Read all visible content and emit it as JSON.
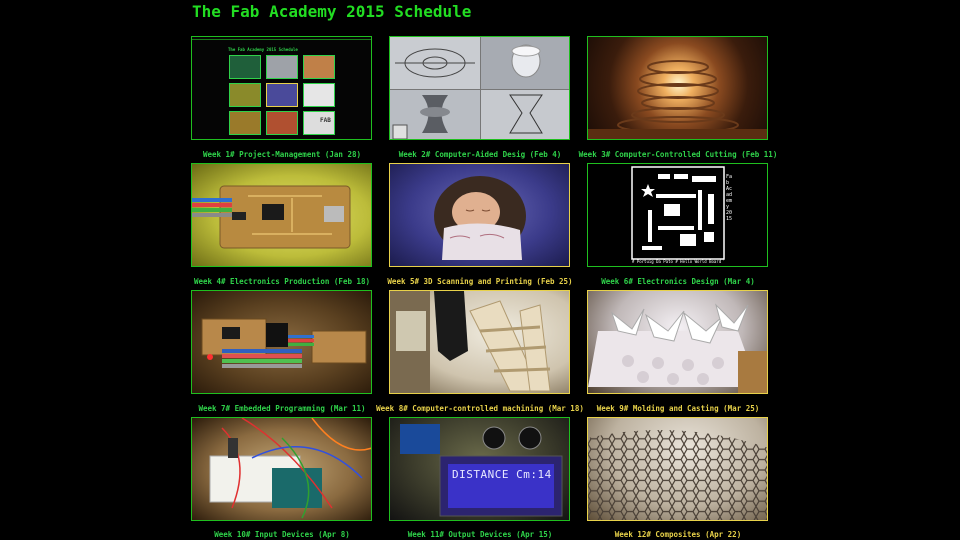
{
  "page": {
    "title": "The Fab Academy 2015 Schedule"
  },
  "weeks": [
    {
      "caption": "Week 1# Project-Management (Jan 28)",
      "image": "website-screenshot-image"
    },
    {
      "caption": "Week 2# Computer-Aided Desig (Feb 4)",
      "image": "cad-render-image"
    },
    {
      "caption": "Week 3# Computer-Controlled Cutting (Feb 11)",
      "image": "lamp-image"
    },
    {
      "caption": "Week 4# Electronics Production (Feb 18)",
      "image": "circuit-board-image"
    },
    {
      "caption": "Week 5# 3D Scanning and Printing (Feb 25)",
      "image": "baby-scan-image"
    },
    {
      "caption": "Week 6# Electronics Design (Mar 4)",
      "image": "pcb-layout-image"
    },
    {
      "caption": "Week 7# Embedded Programming (Mar 11)",
      "image": "programmer-board-image"
    },
    {
      "caption": "Week 8# Computer-controlled machining (Mar 18)",
      "image": "wooden-shelf-image"
    },
    {
      "caption": "Week 9# Molding and Casting (Mar 25)",
      "image": "cast-parts-image"
    },
    {
      "caption": "Week 10# Input Devices (Apr 8)",
      "image": "breadboard-image"
    },
    {
      "caption": "Week 11# Output Devices (Apr 15)",
      "image": "lcd-display-image"
    },
    {
      "caption": "Week 12# Composites (Apr 22)",
      "image": "honeycomb-image"
    }
  ],
  "thumb_texts": {
    "mini_site_title": "The Fab Academy 2015 Schedule",
    "mini_fab_logo": "FAB",
    "pcb_side_text": "Fab Academy 2015",
    "pcb_bottom_text": "# Portuig Da Pato # Hello World Board V1.0",
    "lcd_text": "DISTANCE Cm:14"
  },
  "colors": {
    "background": "#000000",
    "title_green": "#22dd22",
    "border_green": "#1fbf1f",
    "selected_yellow": "#e8d24a"
  }
}
